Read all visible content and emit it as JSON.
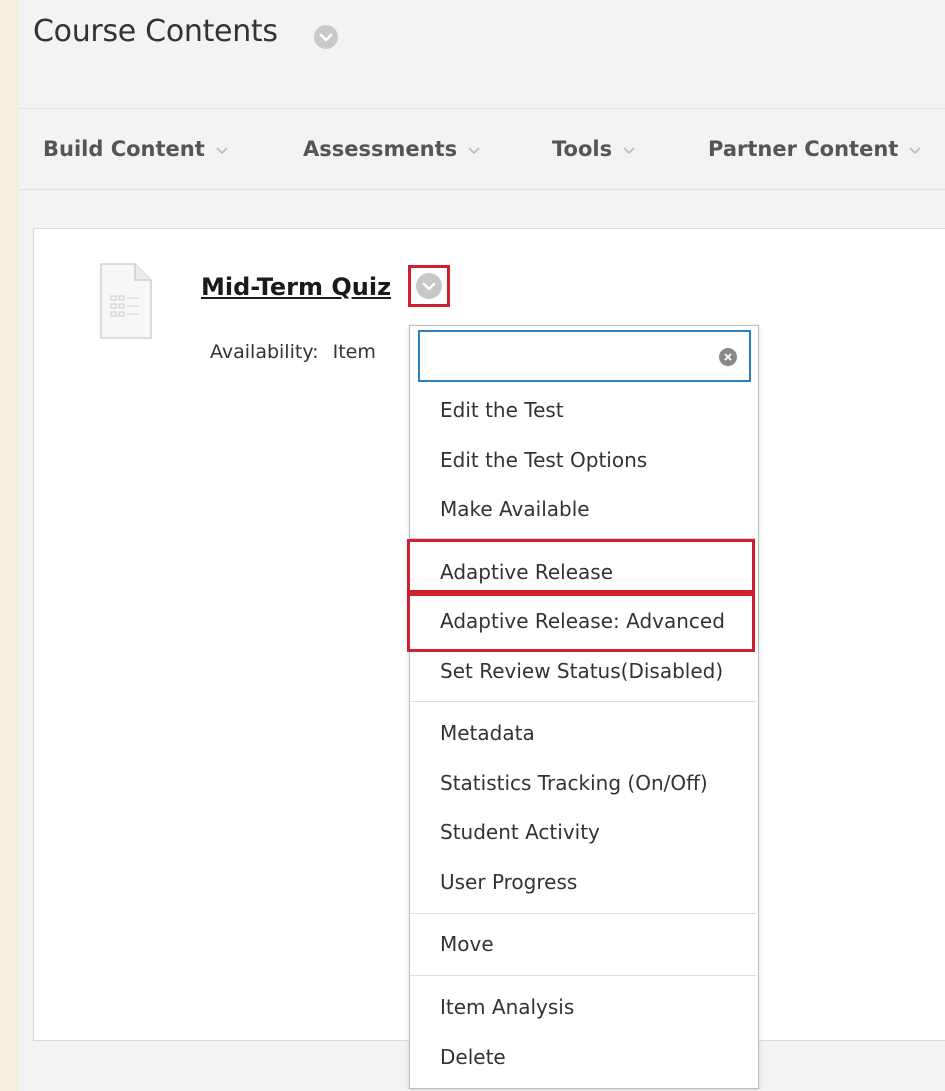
{
  "page": {
    "title": "Course Contents"
  },
  "action_bar": {
    "items": [
      {
        "label": "Build Content"
      },
      {
        "label": "Assessments"
      },
      {
        "label": "Tools"
      },
      {
        "label": "Partner Content"
      }
    ]
  },
  "content_item": {
    "title": "Mid-Term Quiz",
    "availability_label": "Availability:",
    "availability_value": "Item",
    "icon": "test-document-icon"
  },
  "context_menu": {
    "search_value": "",
    "items": [
      {
        "label": "Edit the Test"
      },
      {
        "label": "Edit the Test Options"
      },
      {
        "label": "Make Available"
      },
      {
        "label": "Adaptive Release"
      },
      {
        "label": "Adaptive Release: Advanced"
      },
      {
        "label": "Set Review Status(Disabled)"
      },
      {
        "label": "Metadata"
      },
      {
        "label": "Statistics Tracking (On/Off)"
      },
      {
        "label": "Student Activity"
      },
      {
        "label": "User Progress"
      },
      {
        "label": "Move"
      },
      {
        "label": "Item Analysis"
      },
      {
        "label": "Delete"
      }
    ]
  },
  "colors": {
    "highlight": "#d0202e",
    "search_border": "#2e7fbf",
    "outer_background": "#f5efe0"
  }
}
